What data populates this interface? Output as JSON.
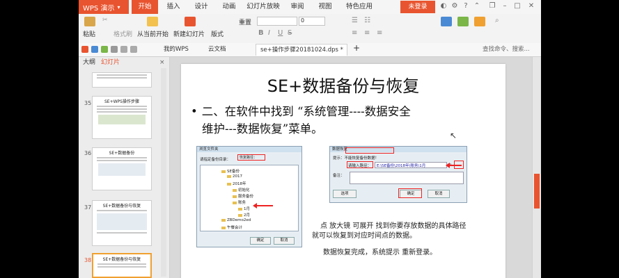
{
  "titlebar": {
    "app_name": "WPS 演示",
    "tabs": [
      "开始",
      "插入",
      "设计",
      "动画",
      "幻灯片放映",
      "审阅",
      "视图",
      "特色应用"
    ],
    "active_tab": "开始",
    "login_label": "未登录"
  },
  "ribbon": {
    "paste": "粘贴",
    "format_painter": "格式刷",
    "from_current_start": "从当前开始",
    "new_slide": "新建幻灯片",
    "layout": "版式",
    "reset": "重置",
    "font_size": "0",
    "bold": "B",
    "italic": "I",
    "underline": "U",
    "strike": "S"
  },
  "quickbar": {
    "my_wps": "我的WPS",
    "cloud_doc": "云文档",
    "doc_tab": "se+操作步骤20181024.dps *",
    "search_hint": "查找命令、搜索..."
  },
  "left_panel": {
    "tab_outline": "大纲",
    "tab_slides": "幻灯片",
    "slides": [
      {
        "num": "35",
        "title": "SE+WPS操作步骤"
      },
      {
        "num": "36",
        "title": "SE+数据备份"
      },
      {
        "num": "37",
        "title": "SE+数据备份与恢复"
      },
      {
        "num": "38",
        "title": "SE+数据备份与恢复"
      }
    ]
  },
  "slide": {
    "title": "SE+数据备份与恢复",
    "bullet_line1": "二、在软件中找到 “系统管理----数据安全",
    "bullet_line2": "维护---数据恢复”菜单。",
    "dialog1": {
      "title": "浏览文件夹",
      "path_label": "请指定备份目录：",
      "path_value": "恢复路径：",
      "tree": [
        "SE备份",
        "2017",
        "2018年",
        "初始化",
        "服务备份",
        "账务",
        "1月",
        "2月",
        "ZBDemo2ed",
        "午餐会计"
      ],
      "ok": "确定",
      "cancel": "取消"
    },
    "dialog2": {
      "title": "数据恢复",
      "prompt": "提示：不能恢复备份数据！",
      "path_label": "请输入路径：",
      "path_value": "E:\\SE备份\\2018年\\账务\\1月",
      "remark": "备注：",
      "btn_option": "选项",
      "btn_ok": "确定",
      "btn_cancel": "取消"
    },
    "note1_line1": "点  放大镜 可展开 找到你要存放数据的具体路径",
    "note1_line2": "就可以恢复到对应时间点的数据。",
    "note2": "数据恢复完成，系统提示 重新登录。"
  },
  "colors": {
    "accent": "#e8542f",
    "highlight": "#e22222"
  }
}
